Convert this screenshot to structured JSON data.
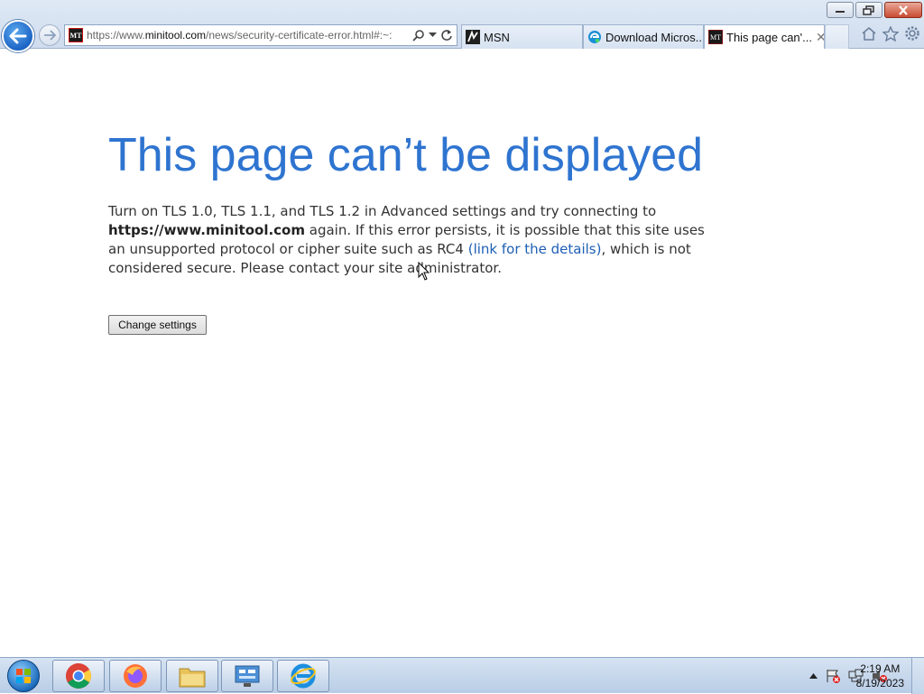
{
  "browser": {
    "address": {
      "url_prefix": "https://www.",
      "url_domain": "minitool.com",
      "url_rest": "/news/security-certificate-error.html#:~:",
      "favicon_text": "MT"
    },
    "tabs": [
      {
        "label": "MSN",
        "icon": "msn-icon"
      },
      {
        "label": "Download Micros...",
        "icon": "edge-icon"
      },
      {
        "label": "This page can'...",
        "icon": "minitool-icon",
        "active": true
      }
    ],
    "tools": [
      "home-icon",
      "favorites-star-icon",
      "settings-gear-icon"
    ]
  },
  "page": {
    "title": "This page can’t be displayed",
    "message_part1": "Turn on TLS 1.0, TLS 1.1, and TLS 1.2 in Advanced settings and try connecting to",
    "message_bold": "https://www.minitool.com",
    "message_part2": " again. If this error persists, it is possible that this site uses an unsupported protocol or cipher suite such as RC4 ",
    "message_link": "(link for the details)",
    "message_part3": ", which is not considered secure. Please contact your site administrator.",
    "button_label": "Change settings"
  },
  "taskbar": {
    "items": [
      "chrome-icon",
      "firefox-icon",
      "file-explorer-icon",
      "control-panel-icon",
      "internet-explorer-icon"
    ],
    "clock_time": "2:19 AM",
    "clock_date": "8/19/2023"
  },
  "colors": {
    "title_blue": "#2e74d0",
    "link_blue": "#1e5fb5"
  }
}
